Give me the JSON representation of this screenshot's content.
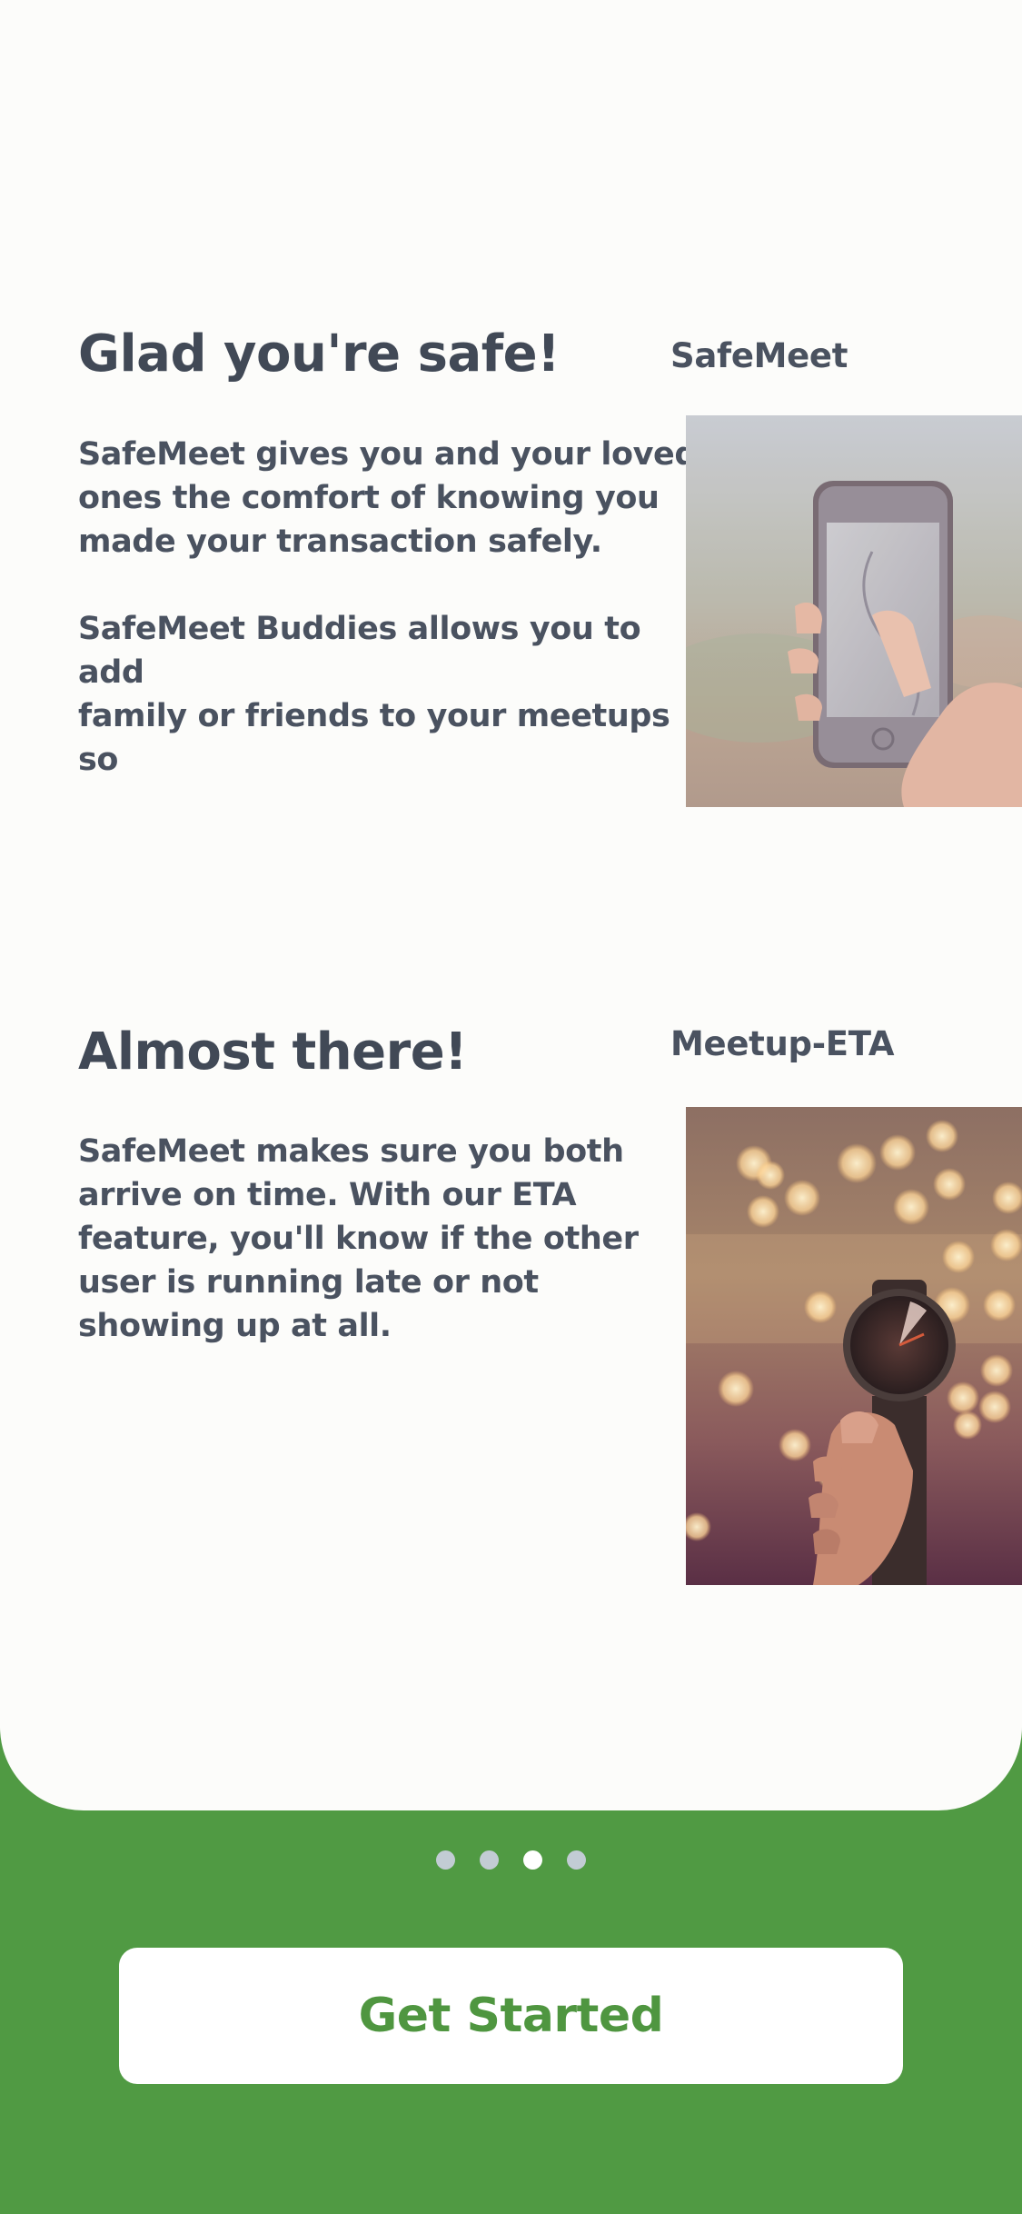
{
  "slides": [
    {
      "heading": "Glad you're safe!",
      "side_title": "SafeMeet",
      "image_subject": "hand holding smartphone showing map",
      "body_lines": [
        "SafeMeet gives you and your loved",
        "ones the comfort of knowing you",
        "made your transaction safely.",
        "",
        "SafeMeet Buddies allows you to",
        "add",
        "family or friends to  your meetups",
        "so"
      ]
    },
    {
      "heading": "Almost there!",
      "side_title": "Meetup-ETA",
      "image_subject": "hand holding wristwatch with bokeh lights",
      "body_lines": [
        "SafeMeet makes sure you both",
        "arrive on time. With our ETA",
        "feature, you'll know if  the other",
        "user is running late or not",
        "showing up at all."
      ]
    }
  ],
  "pagination": {
    "total": 4,
    "active_index": 2
  },
  "cta": {
    "label": "Get Started"
  },
  "colors": {
    "brand_green": "#509a43",
    "card_background": "#fcfcfa",
    "text_dark": "#414956",
    "dot_inactive": "#c2ccd4",
    "dot_active": "#ffffff"
  }
}
